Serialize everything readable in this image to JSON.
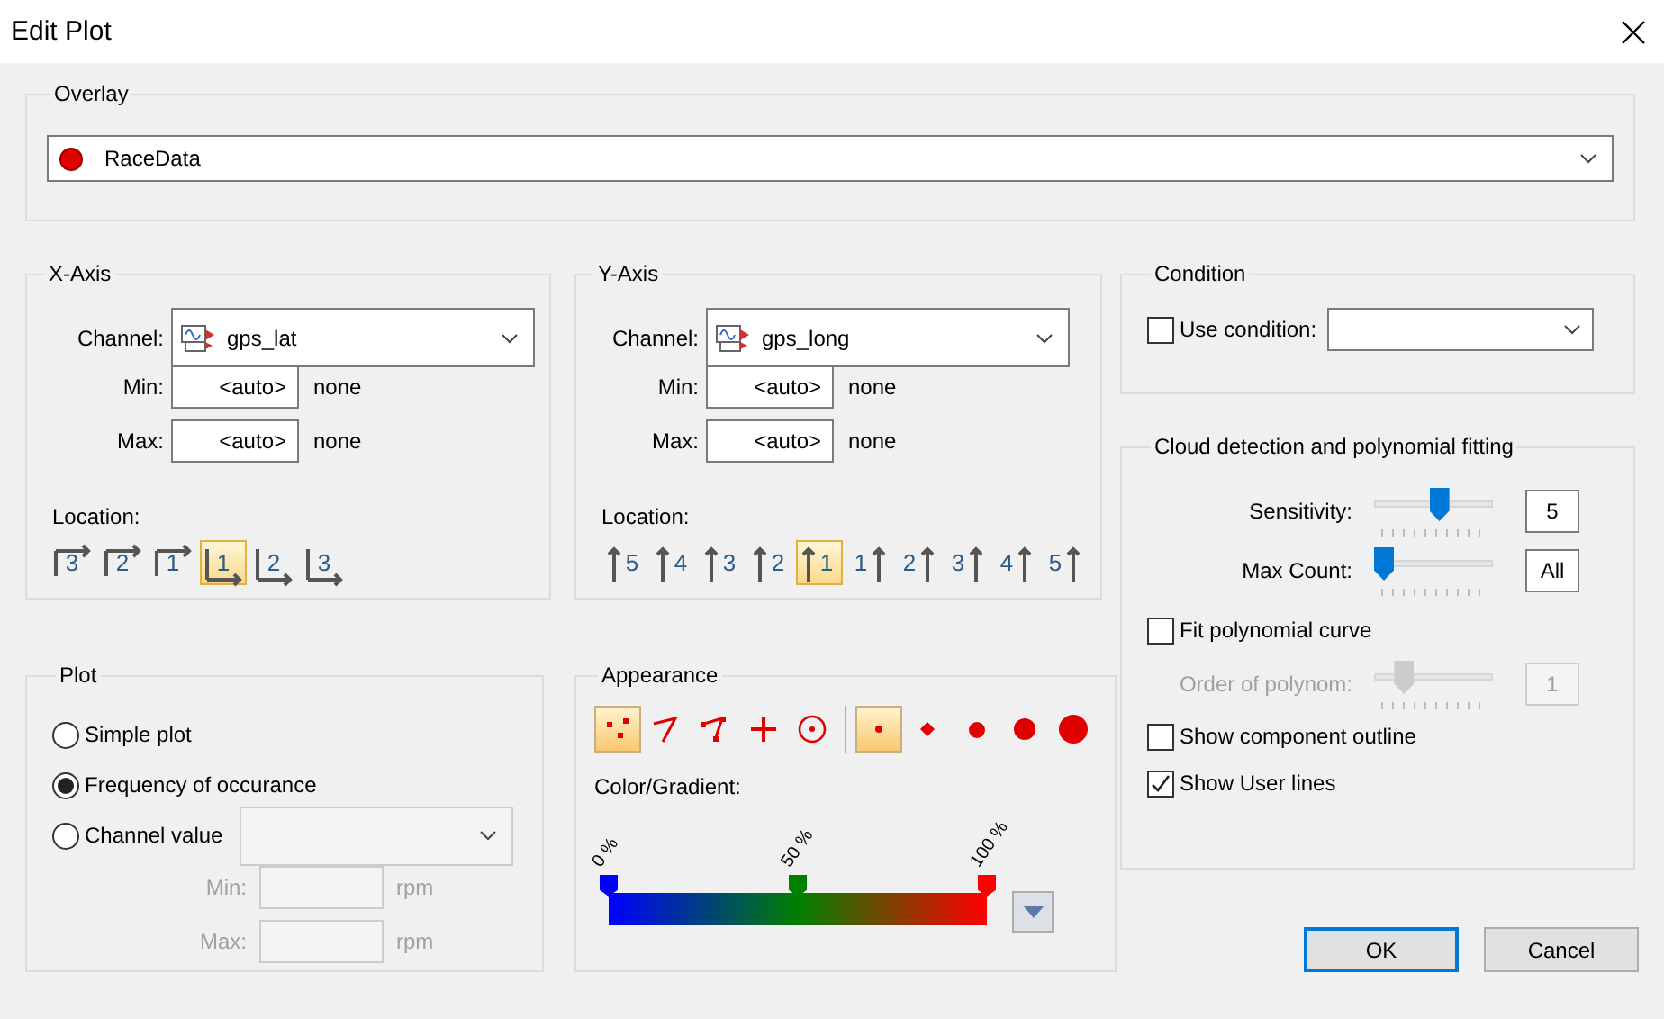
{
  "window": {
    "title": "Edit Plot"
  },
  "overlay": {
    "title": "Overlay",
    "value": "RaceData"
  },
  "x_axis": {
    "title": "X-Axis",
    "channel_label": "Channel:",
    "channel": "gps_lat",
    "min_label": "Min:",
    "min": "<auto>",
    "min_unit": "none",
    "max_label": "Max:",
    "max": "<auto>",
    "max_unit": "none",
    "location_label": "Location:",
    "locations": [
      {
        "label": "3",
        "kind": "above",
        "selected": false
      },
      {
        "label": "2",
        "kind": "above",
        "selected": false
      },
      {
        "label": "1",
        "kind": "above",
        "selected": false
      },
      {
        "label": "1",
        "kind": "below",
        "selected": true
      },
      {
        "label": "2",
        "kind": "below",
        "selected": false
      },
      {
        "label": "3",
        "kind": "below",
        "selected": false
      }
    ]
  },
  "y_axis": {
    "title": "Y-Axis",
    "channel_label": "Channel:",
    "channel": "gps_long",
    "min_label": "Min:",
    "min": "<auto>",
    "min_unit": "none",
    "max_label": "Max:",
    "max": "<auto>",
    "max_unit": "none",
    "location_label": "Location:",
    "locations": [
      {
        "label": "5",
        "kind": "left",
        "selected": false
      },
      {
        "label": "4",
        "kind": "left",
        "selected": false
      },
      {
        "label": "3",
        "kind": "left",
        "selected": false
      },
      {
        "label": "2",
        "kind": "left",
        "selected": false
      },
      {
        "label": "1",
        "kind": "left",
        "selected": true
      },
      {
        "label": "1",
        "kind": "right",
        "selected": false
      },
      {
        "label": "2",
        "kind": "right",
        "selected": false
      },
      {
        "label": "3",
        "kind": "right",
        "selected": false
      },
      {
        "label": "4",
        "kind": "right",
        "selected": false
      },
      {
        "label": "5",
        "kind": "right",
        "selected": false
      }
    ]
  },
  "condition": {
    "title": "Condition",
    "label": "Use condition:",
    "checked": false
  },
  "cloud": {
    "title": "Cloud detection and polynomial fitting",
    "sliders": [
      {
        "label": "Sensitivity:",
        "level": 0.55,
        "value": "5",
        "disabled": false
      },
      {
        "label": "Max Count:",
        "level": 0,
        "value": "All",
        "disabled": false
      }
    ],
    "fit": {
      "label": "Fit polynomial curve",
      "checked": false
    },
    "order": {
      "label": "Order of polynom:",
      "level": 0.2,
      "value": "1",
      "disabled": true
    },
    "options": [
      {
        "label": "Show component outline",
        "checked": false
      },
      {
        "label": "Show User lines",
        "checked": true
      }
    ]
  },
  "plot": {
    "title": "Plot",
    "modes": [
      {
        "label": "Simple plot",
        "selected": false
      },
      {
        "label": "Frequency of occurance",
        "selected": true
      },
      {
        "label": "Channel value",
        "selected": false
      }
    ],
    "min_label": "Min:",
    "min_unit": "rpm",
    "max_label": "Max:",
    "max_unit": "rpm",
    "disabled": true
  },
  "appearance": {
    "title": "Appearance",
    "styles": [
      {
        "kind": "scatter",
        "selected": true
      },
      {
        "kind": "line",
        "selected": false
      },
      {
        "kind": "polyline",
        "selected": false
      },
      {
        "kind": "cross",
        "selected": false
      },
      {
        "kind": "target",
        "selected": false
      }
    ],
    "sizes": [
      {
        "kind": "tiny",
        "selected": true
      },
      {
        "kind": "small",
        "selected": false
      },
      {
        "kind": "medium",
        "selected": false
      },
      {
        "kind": "large",
        "selected": false
      },
      {
        "kind": "huge",
        "selected": false
      }
    ],
    "gradient_label": "Color/Gradient:",
    "stops": [
      {
        "label": "0 %",
        "color": "#0000ff"
      },
      {
        "label": "50 %",
        "color": "#008000"
      },
      {
        "label": "100 %",
        "color": "#ff0000"
      }
    ]
  },
  "buttons": [
    {
      "label": "OK",
      "default": true
    },
    {
      "label": "Cancel",
      "default": false
    }
  ]
}
